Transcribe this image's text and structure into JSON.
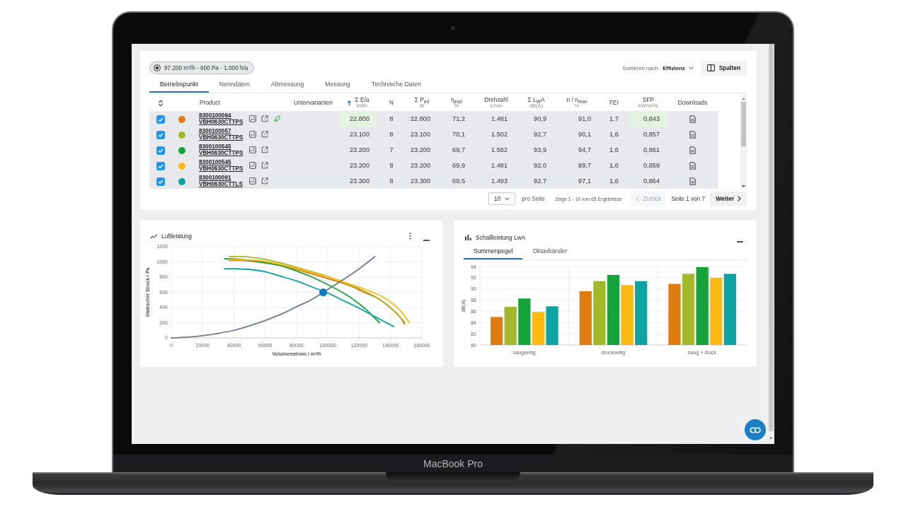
{
  "device": {
    "label": "MacBook Pro"
  },
  "operating_point": {
    "label": "97.200 m³/h - 600 Pa - 1.000 h/a",
    "selected": true
  },
  "sort": {
    "label": "Sortieren nach:",
    "value": "Effizienz"
  },
  "columns_button": {
    "label": "Spalten"
  },
  "tabs": [
    {
      "label": "Betriebspunkt",
      "selected": true
    },
    {
      "label": "Nenndaten",
      "selected": false
    },
    {
      "label": "Abmessung",
      "selected": false
    },
    {
      "label": "Messung",
      "selected": false
    },
    {
      "label": "Technische Daten",
      "selected": false
    }
  ],
  "table": {
    "columns": [
      {
        "label": "Product",
        "sorted": false
      },
      {
        "label": "Untervarianten",
        "sorted": false
      },
      {
        "label": "Σ E/a",
        "unit": "kWh",
        "sorted": true
      },
      {
        "label": "N",
        "sorted": false
      },
      {
        "label": "Σ P$_{ed}$",
        "unit": "W",
        "sorted": false
      },
      {
        "label": "η$_{esd}$",
        "unit": "%",
        "sorted": false
      },
      {
        "label": "Drehzahl",
        "unit": "1/min",
        "sorted": false
      },
      {
        "label": "Σ L$_{W}$A",
        "unit": "dB(A)",
        "sorted": false
      },
      {
        "label": "n / n$_{max}$",
        "unit": "%",
        "sorted": false
      },
      {
        "label": "FEI",
        "sorted": false
      },
      {
        "label": "SFP",
        "unit": "kW/m³/s",
        "sorted": false
      },
      {
        "label": "Downloads",
        "sorted": false
      }
    ],
    "rows": [
      {
        "checked": true,
        "color": "#e07b12",
        "cells": [
          {
            "kind": "product",
            "id": "8300100094",
            "name": "VBH0630CTTPS",
            "eco": true
          },
          {
            "kind": "text",
            "text": ""
          },
          {
            "kind": "text",
            "text": "22.800",
            "highlighted": true
          },
          {
            "kind": "text",
            "text": "8",
            "highlighted": false
          },
          {
            "kind": "text",
            "text": "22.800",
            "highlighted": false
          },
          {
            "kind": "text",
            "text": "71,2",
            "highlighted": false
          },
          {
            "kind": "text",
            "text": "1.481",
            "highlighted": false
          },
          {
            "kind": "text",
            "text": "90,9",
            "highlighted": false
          },
          {
            "kind": "text",
            "text": "91,0",
            "highlighted": false
          },
          {
            "kind": "text",
            "text": "1,7",
            "highlighted": false
          },
          {
            "kind": "text",
            "text": "0,843",
            "highlighted": true
          }
        ]
      },
      {
        "checked": true,
        "color": "#a3b82a",
        "cells": [
          {
            "kind": "product",
            "id": "8300100057",
            "name": "VBH0630CTTPS",
            "eco": false
          },
          {
            "kind": "text",
            "text": ""
          },
          {
            "kind": "text",
            "text": "23.100",
            "highlighted": false
          },
          {
            "kind": "text",
            "text": "8",
            "highlighted": false
          },
          {
            "kind": "text",
            "text": "23.100",
            "highlighted": false
          },
          {
            "kind": "text",
            "text": "70,1",
            "highlighted": false
          },
          {
            "kind": "text",
            "text": "1.502",
            "highlighted": false
          },
          {
            "kind": "text",
            "text": "92,7",
            "highlighted": false
          },
          {
            "kind": "text",
            "text": "90,1",
            "highlighted": false
          },
          {
            "kind": "text",
            "text": "1,6",
            "highlighted": false
          },
          {
            "kind": "text",
            "text": "0,857",
            "highlighted": false
          }
        ]
      },
      {
        "checked": true,
        "color": "#17a33c",
        "cells": [
          {
            "kind": "product",
            "id": "8300100545",
            "name": "VBH0630CTTPS",
            "eco": false
          },
          {
            "kind": "text",
            "text": ""
          },
          {
            "kind": "text",
            "text": "23.200",
            "highlighted": false
          },
          {
            "kind": "text",
            "text": "7",
            "highlighted": false
          },
          {
            "kind": "text",
            "text": "23.200",
            "highlighted": false
          },
          {
            "kind": "text",
            "text": "69,7",
            "highlighted": false
          },
          {
            "kind": "text",
            "text": "1.562",
            "highlighted": false
          },
          {
            "kind": "text",
            "text": "93,9",
            "highlighted": false
          },
          {
            "kind": "text",
            "text": "94,7",
            "highlighted": false
          },
          {
            "kind": "text",
            "text": "1,6",
            "highlighted": false
          },
          {
            "kind": "text",
            "text": "0,861",
            "highlighted": false
          }
        ]
      },
      {
        "checked": true,
        "color": "#fdb913",
        "cells": [
          {
            "kind": "product",
            "id": "8300100545",
            "name": "VBH0630CTTPS",
            "eco": false
          },
          {
            "kind": "text",
            "text": ""
          },
          {
            "kind": "text",
            "text": "23.200",
            "highlighted": false
          },
          {
            "kind": "text",
            "text": "8",
            "highlighted": false
          },
          {
            "kind": "text",
            "text": "23.200",
            "highlighted": false
          },
          {
            "kind": "text",
            "text": "69,9",
            "highlighted": false
          },
          {
            "kind": "text",
            "text": "1.481",
            "highlighted": false
          },
          {
            "kind": "text",
            "text": "92,0",
            "highlighted": false
          },
          {
            "kind": "text",
            "text": "89,7",
            "highlighted": false
          },
          {
            "kind": "text",
            "text": "1,6",
            "highlighted": false
          },
          {
            "kind": "text",
            "text": "0,859",
            "highlighted": false
          }
        ]
      },
      {
        "checked": true,
        "color": "#0fa3a3",
        "cells": [
          {
            "kind": "product",
            "id": "8300100091",
            "name": "VBH0630CTTLS",
            "eco": false
          },
          {
            "kind": "text",
            "text": ""
          },
          {
            "kind": "text",
            "text": "23.300",
            "highlighted": false
          },
          {
            "kind": "text",
            "text": "8",
            "highlighted": false
          },
          {
            "kind": "text",
            "text": "23.300",
            "highlighted": false
          },
          {
            "kind": "text",
            "text": "69,5",
            "highlighted": false
          },
          {
            "kind": "text",
            "text": "1.493",
            "highlighted": false
          },
          {
            "kind": "text",
            "text": "92,7",
            "highlighted": false
          },
          {
            "kind": "text",
            "text": "97,1",
            "highlighted": false
          },
          {
            "kind": "text",
            "text": "1,6",
            "highlighted": false
          },
          {
            "kind": "text",
            "text": "0,864",
            "highlighted": false
          }
        ]
      }
    ]
  },
  "pagination": {
    "page_size": "10",
    "page_size_label": "pro Seite",
    "summary": "Zeige 1 - 10 von 65 Ergebnisse",
    "previous": {
      "label": "Zurück",
      "disabled": true
    },
    "page": "Seite 1 von 7",
    "next": {
      "label": "Weiter",
      "disabled": false
    }
  },
  "panels": [
    {
      "title": "Luftleistung",
      "has_menu": true,
      "chart_data": {
        "type": "line",
        "xlabel": "Volumenstrom / m³/h",
        "ylabel": "Statischer Druck / Pa",
        "xlim": [
          0,
          160000
        ],
        "ylim": [
          0,
          1200
        ],
        "xticks": [
          0,
          20000,
          40000,
          60000,
          80000,
          100000,
          120000,
          140000,
          160000
        ],
        "yticks": [
          0,
          200,
          400,
          600,
          800,
          1000,
          1200
        ],
        "grid": true,
        "series": [
          {
            "color": "#e07b12",
            "x": [
              37000,
              45000,
              55000,
              65000,
              75000,
              85000,
              95000,
              105000,
              115000,
              121000,
              131000,
              138000,
              145000,
              149000
            ],
            "values": [
              1020,
              1020,
              1000,
              970,
              930,
              870,
              810,
              750,
              680,
              620,
              530,
              430,
              300,
              180
            ]
          },
          {
            "color": "#a3b82a",
            "x": [
              37000,
              45000,
              55000,
              65000,
              75000,
              85000,
              95000,
              105000,
              115000,
              125000,
              135000,
              142000,
              149000
            ],
            "values": [
              1070,
              1070,
              1050,
              1010,
              960,
              900,
              840,
              770,
              690,
              600,
              480,
              360,
              210
            ]
          },
          {
            "color": "#17a33c",
            "x": [
              34000,
              40000,
              50000,
              60000,
              70000,
              80000,
              90000,
              100000,
              110000,
              118000,
              124000,
              128000,
              133000
            ],
            "values": [
              1040,
              1040,
              1020,
              990,
              950,
              880,
              800,
              700,
              590,
              480,
              380,
              300,
              200
            ]
          },
          {
            "color": "#fdb913",
            "x": [
              37000,
              45000,
              55000,
              65000,
              75000,
              85000,
              95000,
              105000,
              115000,
              125000,
              135000,
              142000,
              147000,
              152000
            ],
            "values": [
              1030,
              1030,
              1020,
              990,
              940,
              890,
              830,
              770,
              700,
              630,
              540,
              440,
              340,
              200
            ]
          },
          {
            "color": "#0fa3a3",
            "x": [
              34000,
              40000,
              50000,
              60000,
              70000,
              80000,
              90000,
              100000,
              110000,
              120000,
              130000,
              142000
            ],
            "values": [
              910,
              910,
              900,
              870,
              810,
              750,
              670,
              590,
              490,
              390,
              280,
              150
            ]
          },
          {
            "color": "#707c8c",
            "x": [
              0,
              10000,
              20000,
              30000,
              40000,
              50000,
              60000,
              70000,
              80000,
              90000,
              100000,
              110000,
              120000,
              130000
            ],
            "values": [
              0,
              10,
              30,
              60,
              100,
              160,
              230,
              310,
              410,
              510,
              640,
              770,
              910,
              1070
            ]
          },
          {
            "color": "#0b78c2",
            "x": [
              97000
            ],
            "values": [
              600
            ],
            "marker": true
          }
        ]
      }
    },
    {
      "title": "Schallleistung LwA",
      "has_menu": false,
      "tabs": [
        {
          "label": "Summenpegel",
          "selected": true
        },
        {
          "label": "Oktavbänder",
          "selected": false
        }
      ],
      "chart_data": {
        "type": "bar",
        "ylabel": "dB(A)",
        "categories": [
          "saugseitig",
          "druckseitig",
          "saug + druck"
        ],
        "ylim": [
          80,
          94
        ],
        "yticks": [
          80,
          82,
          84,
          86,
          88,
          90,
          92,
          94
        ],
        "grid": true,
        "series": [
          {
            "color": "#e07b12",
            "values": [
              85.0,
              89.6,
              90.9
            ]
          },
          {
            "color": "#a3b82a",
            "values": [
              86.8,
              91.4,
              92.7
            ]
          },
          {
            "color": "#17a33c",
            "values": [
              88.3,
              92.5,
              93.9
            ]
          },
          {
            "color": "#fdb913",
            "values": [
              85.9,
              90.7,
              92.0
            ]
          },
          {
            "color": "#0fa3a3",
            "values": [
              86.9,
              91.4,
              92.7
            ]
          }
        ]
      }
    }
  ]
}
